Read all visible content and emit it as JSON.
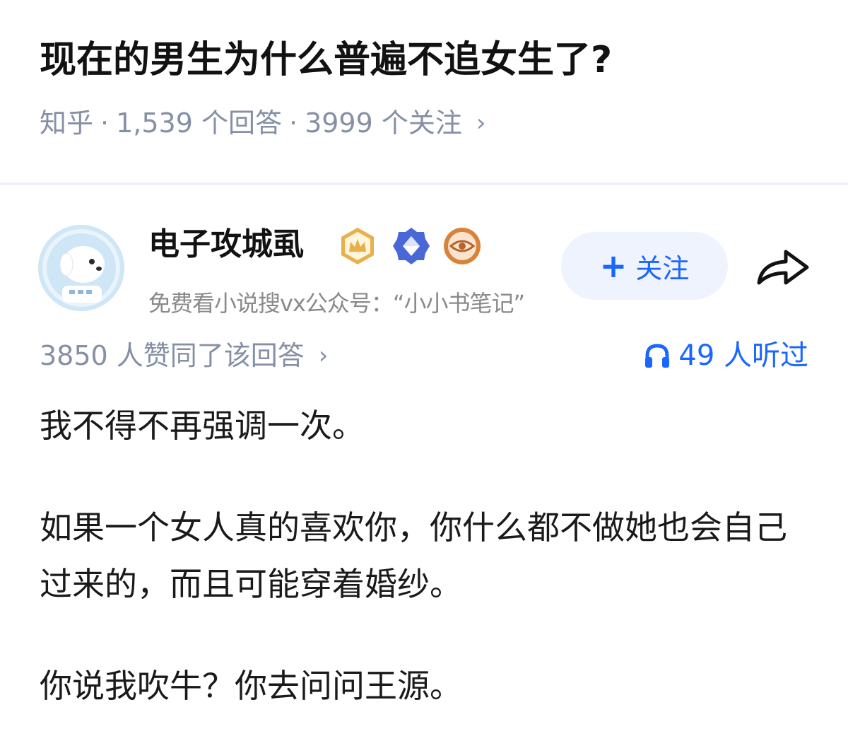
{
  "question": {
    "title": "现在的男生为什么普遍不追女生了?",
    "source": "知乎",
    "answers": "1,539 个回答",
    "follows": "3999 个关注",
    "separator": "·",
    "chevron": "›"
  },
  "author": {
    "name": "电子攻城虱",
    "signature": "免费看小说搜vx公众号：“小小书笔记”",
    "badges": [
      "crown-badge-icon",
      "diamond-badge-icon",
      "eye-badge-icon"
    ],
    "avatar_icon": "astronaut-dog-avatar"
  },
  "actions": {
    "follow_plus": "+",
    "follow_label": "关注",
    "share_icon": "share-arrow-icon"
  },
  "stats": {
    "upvotes": "3850 人赞同了该回答",
    "chevron": "›",
    "listens": "49 人听过",
    "listen_icon": "headphones-icon"
  },
  "answer": {
    "paragraph_1": "我不得不再强调一次。",
    "paragraph_2": "如果一个女人真的喜欢你，你什么都不做她也会自己过来的，而且可能穿着婚纱。",
    "paragraph_3": "你说我吹牛？你去问问王源。"
  },
  "colors": {
    "accent": "#1a66ff",
    "meta_gray": "#8590a6",
    "follow_bg": "#eef3fe",
    "badge_gold": "#e8b04b",
    "badge_blue": "#4a67d8",
    "badge_orange": "#d9833a"
  }
}
